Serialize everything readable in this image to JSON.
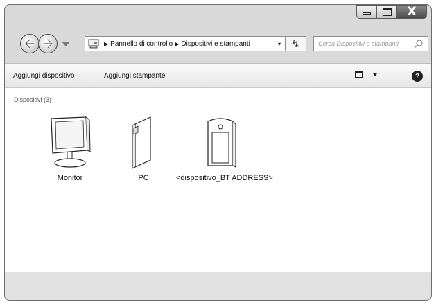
{
  "window": {
    "controls": {
      "minimize": "minimize",
      "maximize": "maximize",
      "close": "X"
    }
  },
  "nav": {
    "back_icon": "back-arrow-icon",
    "forward_icon": "forward-arrow-icon"
  },
  "address": {
    "icon": "control-panel-icon",
    "crumbs": [
      "Pannello di controllo",
      "Dispositivi e stampanti"
    ],
    "dropdown": "▾"
  },
  "search": {
    "placeholder": "Cerca Dispositivi e stampanti",
    "icon": "search-icon"
  },
  "toolbar": {
    "add_device": "Aggiungi dispositivo",
    "add_printer": "Aggiungi stampante",
    "help": "?"
  },
  "group": {
    "title": "Dispositivi (3)"
  },
  "devices": [
    {
      "label": "Monitor",
      "icon": "monitor-icon"
    },
    {
      "label": "PC",
      "icon": "pc-icon"
    },
    {
      "label": "<dispositivo_BT ADDRESS>",
      "icon": "bluetooth-device-icon"
    }
  ],
  "colors": {
    "chrome": "#d9d9d9",
    "toolbar": "#f0f0f0",
    "content": "#ffffff",
    "close_button": "#5a5a5a"
  }
}
